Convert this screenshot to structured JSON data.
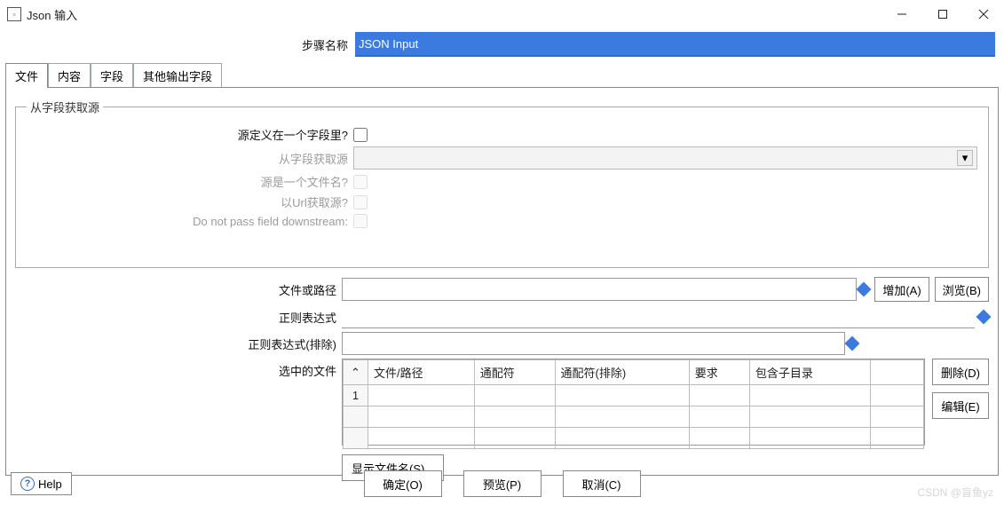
{
  "window": {
    "title": "Json 输入",
    "icon": "□"
  },
  "step": {
    "label": "步骤名称",
    "value": "JSON Input"
  },
  "tabs": [
    "文件",
    "内容",
    "字段",
    "其他输出字段"
  ],
  "group": {
    "legend": "从字段获取源",
    "rows": {
      "src_in_field": "源定义在一个字段里?",
      "from_field": "从字段获取源",
      "src_is_filename": "源是一个文件名?",
      "from_url": "以Url获取源?",
      "no_pass": "Do not pass field downstream:"
    }
  },
  "fields": {
    "file_or_path": "文件或路径",
    "regex": "正则表达式",
    "regex_exclude": "正则表达式(排除)",
    "selected_files": "选中的文件"
  },
  "buttons": {
    "add": "增加(A)",
    "browse": "浏览(B)",
    "delete": "删除(D)",
    "edit": "编辑(E)",
    "show_files": "显示文件名(S)...",
    "ok": "确定(O)",
    "preview": "预览(P)",
    "cancel": "取消(C)",
    "help": "Help"
  },
  "table": {
    "headers": {
      "num": "#",
      "file_path": "文件/路径",
      "wildcard": "通配符",
      "wildcard_exclude": "通配符(排除)",
      "required": "要求",
      "include_subdir": "包含子目录"
    },
    "rows": [
      {
        "num": "1",
        "file_path": "",
        "wildcard": "",
        "wildcard_exclude": "",
        "required": "",
        "include_subdir": ""
      }
    ]
  },
  "watermark": "CSDN @盲鱼yz"
}
